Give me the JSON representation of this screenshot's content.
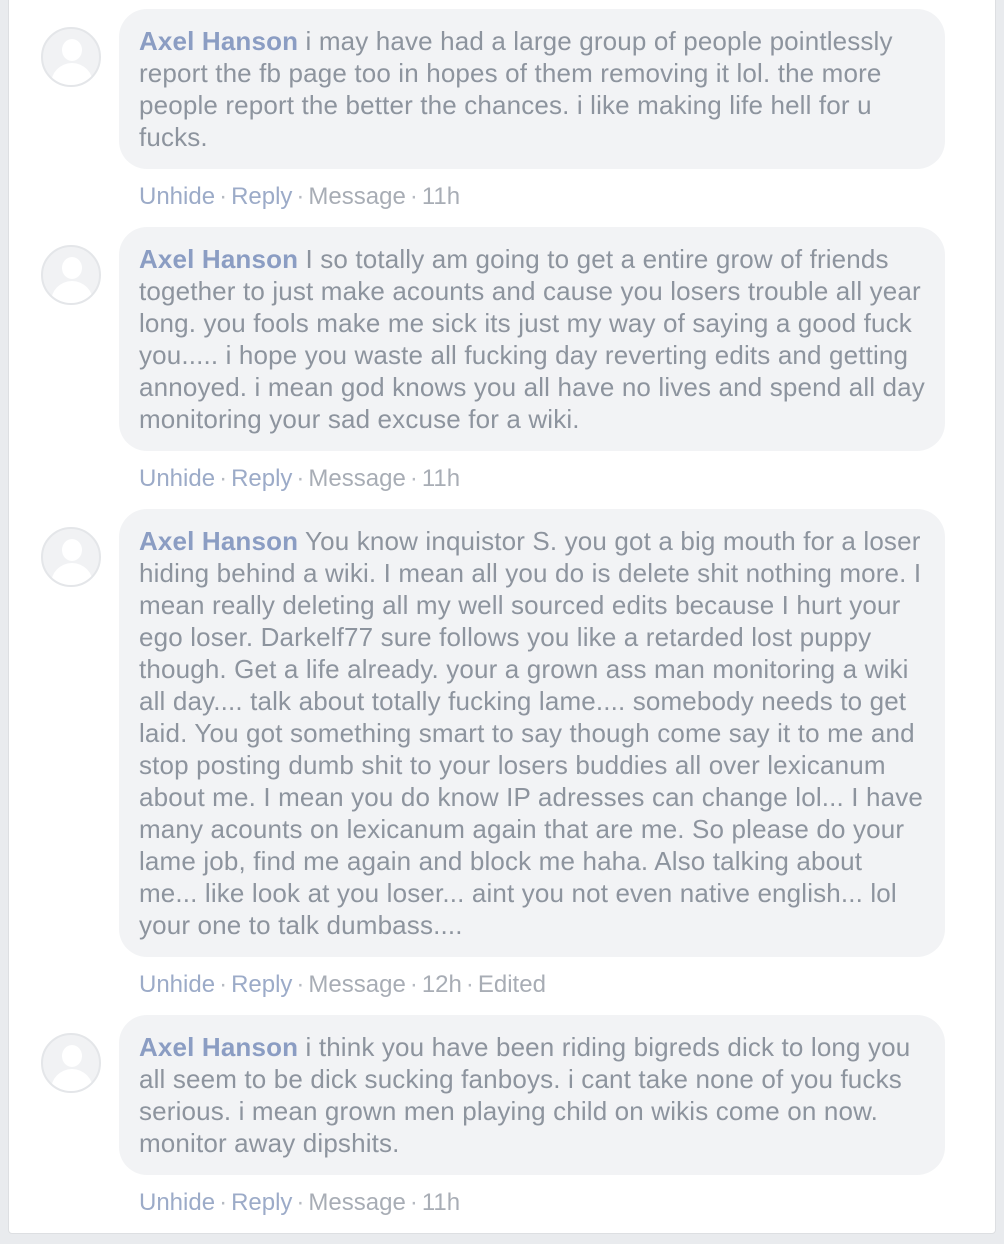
{
  "comments": [
    {
      "author": "Axel Hanson",
      "text": "i may have had a large group of people pointlessly report the fb page too in hopes of them removing it lol. the more people report the better the chances. i like making life hell for u fucks.",
      "actions": {
        "unhide": "Unhide",
        "reply": "Reply",
        "message": "Message",
        "time": "11h",
        "edited": ""
      }
    },
    {
      "author": "Axel Hanson",
      "text": "I so totally am going to get a entire grow of friends together to just make acounts and cause you losers trouble all year long. you fools make me sick its just my way of saying a good fuck you..... i hope you waste all fucking day reverting edits and getting annoyed. i mean god knows you all have no lives and spend all day monitoring your sad excuse for a wiki.",
      "actions": {
        "unhide": "Unhide",
        "reply": "Reply",
        "message": "Message",
        "time": "11h",
        "edited": ""
      }
    },
    {
      "author": "Axel Hanson",
      "text": "You know inquistor S. you got a big mouth for a loser hiding behind a wiki. I mean all you do is delete shit nothing more. I mean really deleting all my well sourced edits because I hurt your ego loser. Darkelf77 sure follows you like a retarded lost puppy though. Get a life already. your a grown ass man monitoring a wiki all day.... talk about totally fucking lame.... somebody needs to get laid. You got something smart to say though come say it to me and stop posting dumb shit to your losers buddies all over lexicanum about me. I mean you do know IP adresses can change lol... I have many acounts on lexicanum again that are me. So please do your lame job, find me again and block me haha. Also talking about me... like look at you loser... aint you not even native english... lol your one to talk dumbass....",
      "actions": {
        "unhide": "Unhide",
        "reply": "Reply",
        "message": "Message",
        "time": "12h",
        "edited": "Edited"
      }
    },
    {
      "author": "Axel Hanson",
      "text": "i think you have been riding bigreds dick to long you all seem to be dick sucking fanboys. i cant take none of you fucks serious. i mean grown men playing child on wikis come on now. monitor away dipshits.",
      "actions": {
        "unhide": "Unhide",
        "reply": "Reply",
        "message": "Message",
        "time": "11h",
        "edited": ""
      }
    }
  ]
}
